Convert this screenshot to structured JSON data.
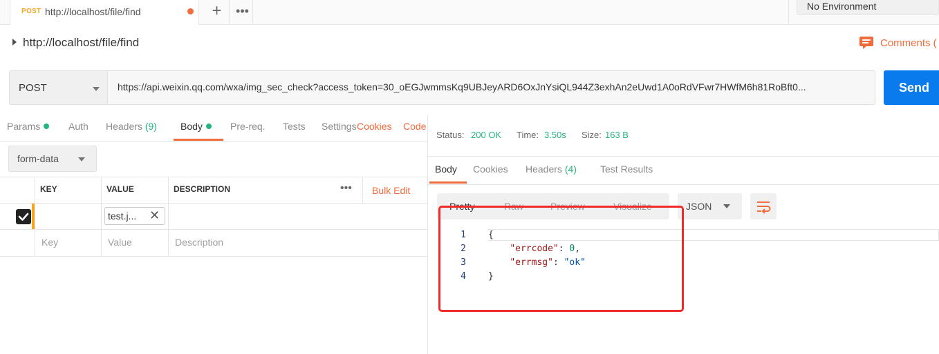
{
  "tab": {
    "method": "POST",
    "name": "http://localhost/file/find",
    "unsaved": true
  },
  "tab_bar": {
    "add_label": "+",
    "more_label": "•••"
  },
  "environment": {
    "selected": "No Environment"
  },
  "request": {
    "title": "http://localhost/file/find",
    "comments_label": "Comments (",
    "method": "POST",
    "url": "https://api.weixin.qq.com/wxa/img_sec_check?access_token=30_oEGJwmmsKq9UBJeyARD6OxJnYsiQL944Z3exhAn2eUwd1A0oRdVFwr7HWfM6h81RoBft0...",
    "send_label": "Send"
  },
  "request_tabs": {
    "params": "Params",
    "auth": "Auth",
    "headers": "Headers",
    "headers_count": "(9)",
    "body": "Body",
    "prereq": "Pre-req.",
    "tests": "Tests",
    "settings": "Settings",
    "cookies": "Cookies",
    "code": "Code"
  },
  "body_mode": {
    "selected": "form-data"
  },
  "params_table": {
    "headers": {
      "key": "KEY",
      "value": "VALUE",
      "description": "DESCRIPTION"
    },
    "more_label": "•••",
    "bulk_edit": "Bulk Edit",
    "rows": [
      {
        "checked": true,
        "key": "",
        "value": "test.j...",
        "description": ""
      }
    ],
    "placeholders": {
      "key": "Key",
      "value": "Value",
      "description": "Description"
    }
  },
  "response": {
    "status_label": "Status:",
    "status_value": "200 OK",
    "time_label": "Time:",
    "time_value": "3.50s",
    "size_label": "Size:",
    "size_value": "163 B",
    "tabs": {
      "body": "Body",
      "cookies": "Cookies",
      "headers": "Headers",
      "headers_count": "(4)",
      "test_results": "Test Results"
    },
    "view_modes": {
      "pretty": "Pretty",
      "raw": "Raw",
      "preview": "Preview",
      "visualize": "Visualize"
    },
    "format": "JSON",
    "code_lines": [
      {
        "num": "1",
        "open": "{"
      },
      {
        "num": "2",
        "key": "\"errcode\"",
        "sep": ": ",
        "value": "0",
        "tail": ","
      },
      {
        "num": "3",
        "key": "\"errmsg\"",
        "sep": ": ",
        "value": "\"ok\"",
        "tail": ""
      },
      {
        "num": "4",
        "close": "}"
      }
    ]
  },
  "colors": {
    "accent": "#f26b3a",
    "send": "#097bed",
    "success": "#26b47f",
    "annotation": "#ef2a2a"
  }
}
